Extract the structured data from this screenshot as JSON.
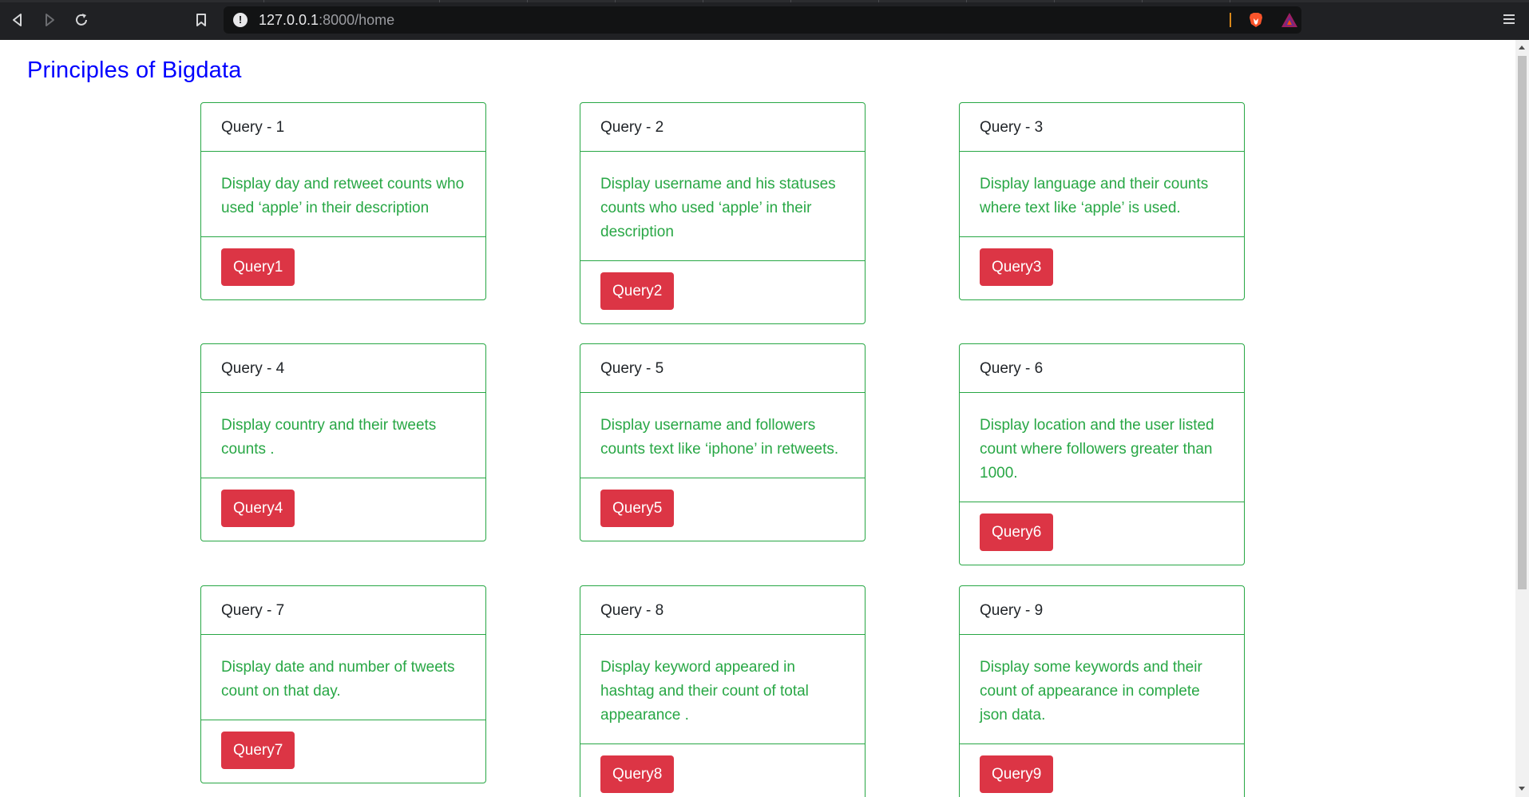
{
  "browser": {
    "url_host": "127.0.0.1",
    "url_path": ":8000/home"
  },
  "page": {
    "title": "Principles of Bigdata"
  },
  "cards": [
    {
      "header": "Query - 1",
      "body": "Display day and retweet counts who used ‘apple’ in their description",
      "button": "Query1"
    },
    {
      "header": "Query - 2",
      "body": "Display username and his statuses counts who used ‘apple’ in their description",
      "button": "Query2"
    },
    {
      "header": "Query - 3",
      "body": "Display language and their counts where text like ‘apple’ is used.",
      "button": "Query3"
    },
    {
      "header": "Query - 4",
      "body": "Display country and their tweets counts .",
      "button": "Query4"
    },
    {
      "header": "Query - 5",
      "body": "Display username and followers counts text like ‘iphone’ in retweets.",
      "button": "Query5"
    },
    {
      "header": "Query - 6",
      "body": "Display location and the user listed count where followers greater than 1000.",
      "button": "Query6"
    },
    {
      "header": "Query - 7",
      "body": "Display date and number of tweets count on that day.",
      "button": "Query7"
    },
    {
      "header": "Query - 8",
      "body": "Display keyword appeared in hashtag and their count of total appearance .",
      "button": "Query8"
    },
    {
      "header": "Query - 9",
      "body": "Display some keywords and their count of appearance in complete json data.",
      "button": "Query9"
    }
  ],
  "colors": {
    "title": "#0000ff",
    "card_border": "#28a745",
    "card_text": "#28a745",
    "button": "#dc3545"
  }
}
